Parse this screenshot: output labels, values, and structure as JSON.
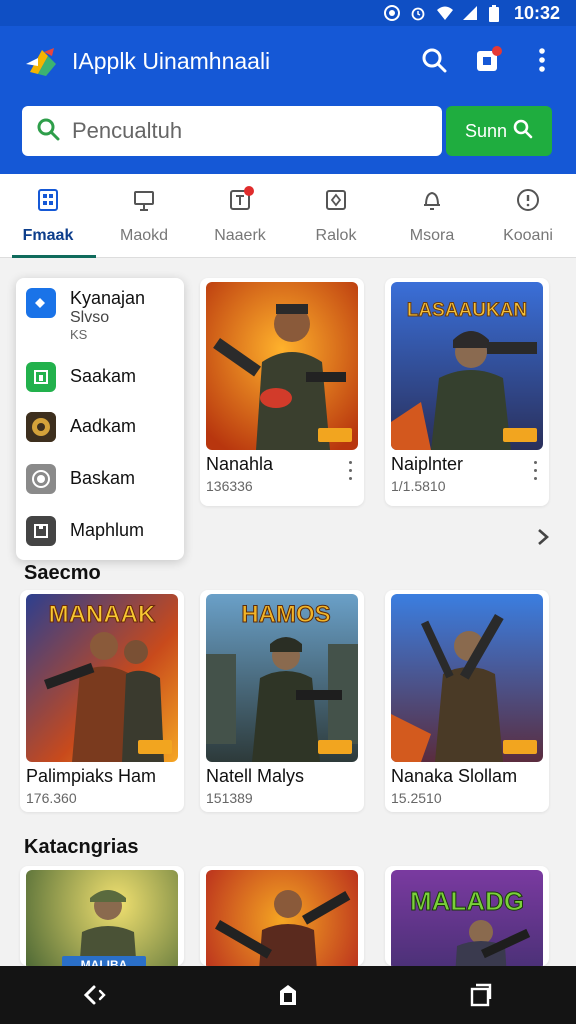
{
  "status_bar": {
    "time": "10:32",
    "icons": [
      "location-icon",
      "alarm-icon",
      "wifi-icon",
      "signal-icon",
      "battery-icon"
    ]
  },
  "app": {
    "title": "IApplk Uinamhnaali",
    "brand_color": "#1558d6",
    "accent_green": "#1fad3f"
  },
  "search": {
    "placeholder": "Pencualtuh",
    "button_label": "Sunn"
  },
  "tabs": [
    {
      "label": "Fmaak",
      "icon": "grid-icon",
      "active": true
    },
    {
      "label": "Maokd",
      "icon": "gift-icon",
      "active": false
    },
    {
      "label": "Naaerk",
      "icon": "notification-icon",
      "active": false,
      "badge": true
    },
    {
      "label": "Ralok",
      "icon": "box-icon",
      "active": false
    },
    {
      "label": "Msora",
      "icon": "bell-icon",
      "active": false
    },
    {
      "label": "Kooani",
      "icon": "info-icon",
      "active": false
    }
  ],
  "popup_menu": {
    "items": [
      {
        "label": "Kyanajan",
        "sub": "Slvso",
        "sub2": "KS",
        "icon": "app-blue-icon"
      },
      {
        "label": "Saakam",
        "icon": "app-green-icon"
      },
      {
        "label": "Aadkam",
        "icon": "game-thumb-icon"
      },
      {
        "label": "Baskam",
        "icon": "camera-icon"
      },
      {
        "label": "Maphlum",
        "icon": "puzzle-icon"
      }
    ]
  },
  "featured": [
    {
      "name": "Nanahla",
      "count": "136336",
      "title_art": ""
    },
    {
      "name": "Naiplnter",
      "count": "1/1.5810",
      "title_art": "LASAAUKAN"
    }
  ],
  "section_1": {
    "title": "Saecmo"
  },
  "section_1_items": [
    {
      "name": "Palimpiaks Ham",
      "count": "176.360",
      "title_art": "MANAAK"
    },
    {
      "name": "Natell Malys",
      "count": "151389",
      "title_art": "HAMOS"
    },
    {
      "name": "Nanaka Slollam",
      "count": "15.2510",
      "title_art": ""
    }
  ],
  "section_2": {
    "title": "Katacngrias"
  },
  "section_2_items": [
    {
      "title_art": "MALIBA"
    },
    {
      "title_art": ""
    },
    {
      "title_art": "MALADG"
    }
  ]
}
